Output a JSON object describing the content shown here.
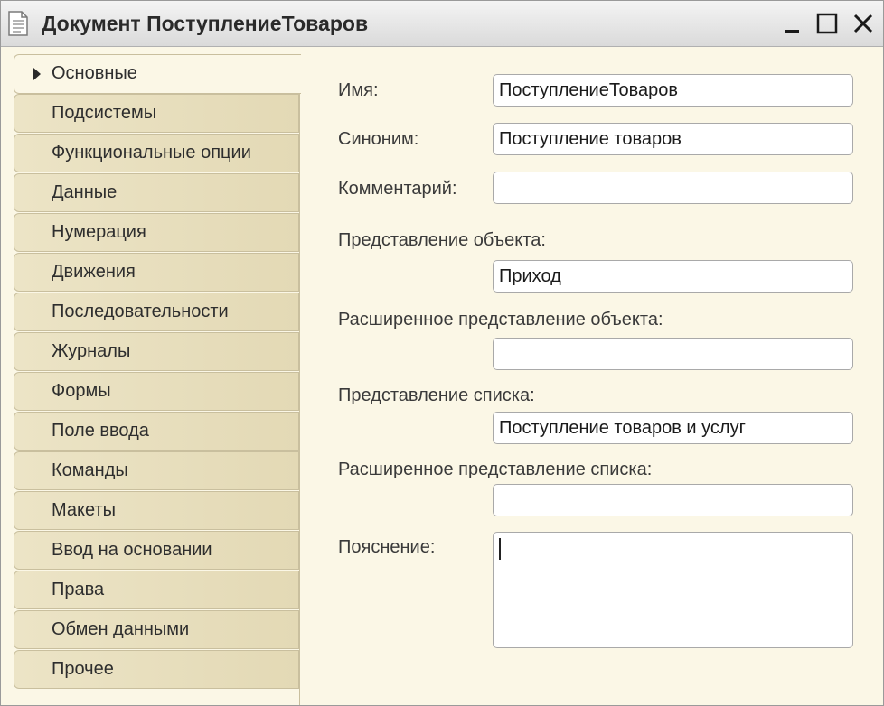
{
  "window": {
    "title": "Документ ПоступлениеТоваров"
  },
  "tabs": [
    {
      "label": "Основные",
      "active": true
    },
    {
      "label": "Подсистемы"
    },
    {
      "label": "Функциональные опции"
    },
    {
      "label": "Данные"
    },
    {
      "label": "Нумерация"
    },
    {
      "label": "Движения"
    },
    {
      "label": "Последовательности"
    },
    {
      "label": "Журналы"
    },
    {
      "label": "Формы"
    },
    {
      "label": "Поле ввода"
    },
    {
      "label": "Команды"
    },
    {
      "label": "Макеты"
    },
    {
      "label": "Ввод на основании"
    },
    {
      "label": "Права"
    },
    {
      "label": "Обмен данными"
    },
    {
      "label": "Прочее"
    }
  ],
  "form": {
    "name_label": "Имя:",
    "name_value": "ПоступлениеТоваров",
    "synonym_label": "Синоним:",
    "synonym_value": "Поступление товаров",
    "comment_label": "Комментарий:",
    "comment_value": "",
    "object_presentation_label": "Представление объекта:",
    "object_presentation_value": "Приход",
    "ext_object_presentation_label": "Расширенное представление объекта:",
    "ext_object_presentation_value": "",
    "list_presentation_label": "Представление списка:",
    "list_presentation_value": "Поступление товаров и услуг",
    "ext_list_presentation_label": "Расширенное представление списка:",
    "ext_list_presentation_value": "",
    "explanation_label": "Пояснение:",
    "explanation_value": ""
  },
  "icons": {
    "title": "document-icon",
    "minimize": "minimize-icon",
    "maximize": "maximize-icon",
    "close": "close-icon",
    "active_tab": "triangle-right-icon"
  },
  "colors": {
    "panel_bg": "#fbf7e6",
    "tab_bg": "#e8dfbf",
    "tab_border": "#c9bf9e"
  }
}
